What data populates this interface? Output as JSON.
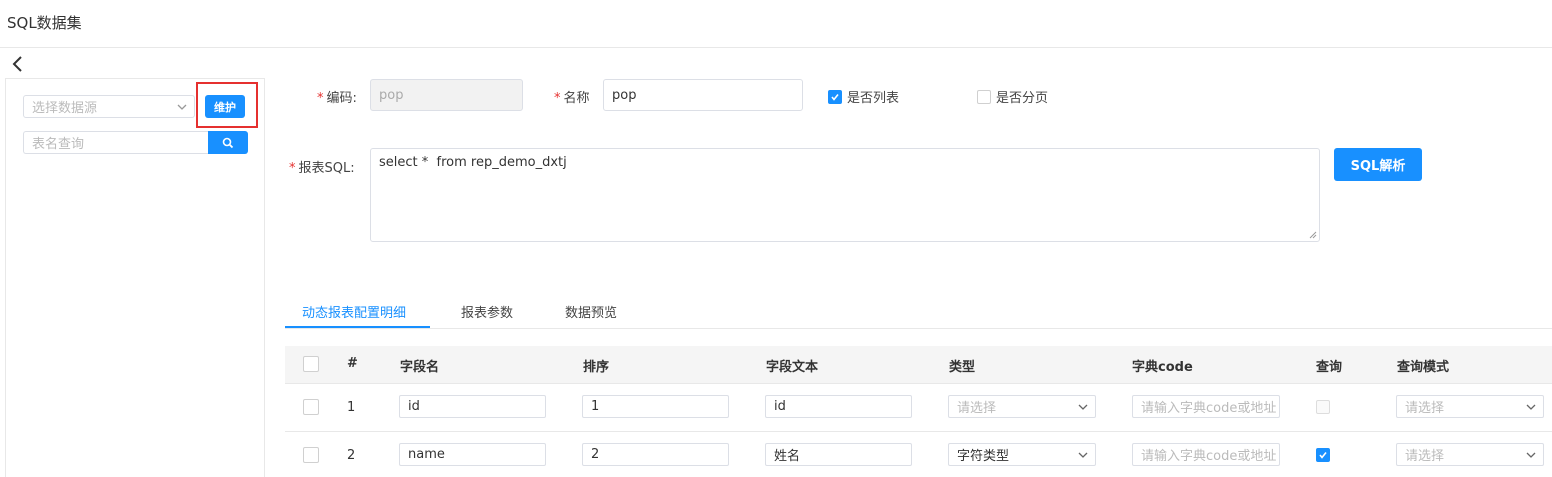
{
  "page": {
    "title": "SQL数据集"
  },
  "left": {
    "datasource_placeholder": "选择数据源",
    "maintain_label": "维护",
    "table_search_placeholder": "表名查询"
  },
  "form": {
    "code_label": "编码:",
    "code_value": "pop",
    "name_label": "名称",
    "name_value": "pop",
    "is_list_label": "是否列表",
    "is_list_checked": true,
    "is_page_label": "是否分页",
    "is_page_checked": false,
    "sql_label": "报表SQL:",
    "sql_value": "select *  from rep_demo_dxtj",
    "sql_parse_label": "SQL解析",
    "required_mark": "*"
  },
  "tabs": [
    {
      "label": "动态报表配置明细",
      "active": true
    },
    {
      "label": "报表参数",
      "active": false
    },
    {
      "label": "数据预览",
      "active": false
    }
  ],
  "table": {
    "headers": {
      "num": "#",
      "field": "字段名",
      "order": "排序",
      "text": "字段文本",
      "type": "类型",
      "dict": "字典code",
      "query": "查询",
      "mode": "查询模式"
    },
    "rows": [
      {
        "num": "1",
        "field": "id",
        "order": "1",
        "text": "id",
        "type": "请选择",
        "type_placeholder": true,
        "dict_placeholder": "请输入字典code或地址",
        "query": false,
        "mode": "请选择"
      },
      {
        "num": "2",
        "field": "name",
        "order": "2",
        "text": "姓名",
        "type": "字符类型",
        "type_placeholder": false,
        "dict_placeholder": "请输入字典code或地址",
        "query": true,
        "mode": "请选择"
      }
    ]
  },
  "colors": {
    "primary": "#1890ff",
    "highlight": "#e5302f",
    "required": "#e5302f"
  }
}
